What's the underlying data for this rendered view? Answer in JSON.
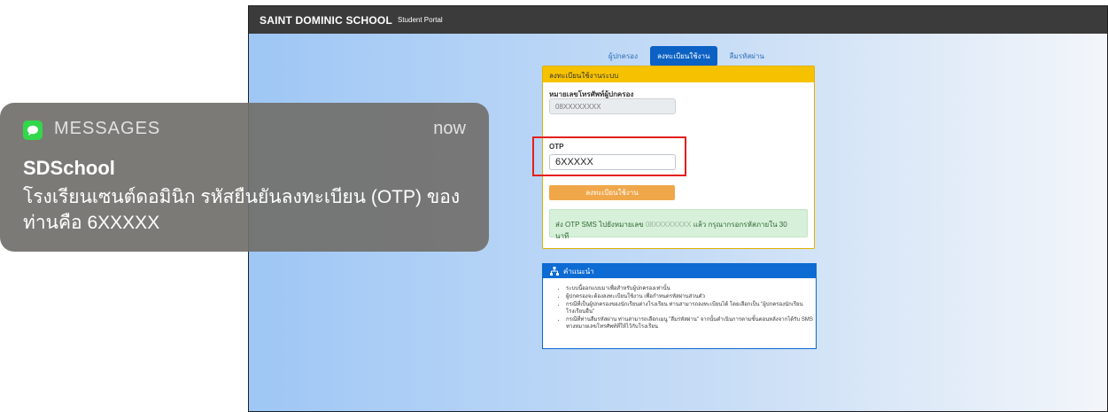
{
  "portal": {
    "brand": "SAINT DOMINIC SCHOOL",
    "brand_sub": "Student Portal",
    "tabs": [
      {
        "label": "ผู้ปกครอง",
        "active": false
      },
      {
        "label": "ลงทะเบียนใช้งาน",
        "active": true
      },
      {
        "label": "ลืมรหัสผ่าน",
        "active": false
      }
    ],
    "register_card": {
      "header": "ลงทะเบียนใช้งานระบบ",
      "phone_label": "หมายเลขโทรศัพท์ผู้ปกครอง",
      "phone_value": "08XXXXXXXX",
      "otp_label": "OTP",
      "otp_value": "6XXXXX",
      "submit_label": "ลงทะเบียนใช้งาน",
      "notice_prefix": "ส่ง OTP SMS ไปยังหมายเลข",
      "notice_number": "08XXXXXXXX",
      "notice_suffix": "แล้ว กรุณากรอกรหัสภายใน 30 นาที"
    },
    "info_card": {
      "header": "คำแนะนำ",
      "items": [
        "ระบบนี้ออกแบบมาเพื่อสำหรับผู้ปกครองเท่านั้น",
        "ผู้ปกครองจะต้องลงทะเบียนใช้งาน เพื่อกำหนดรหัสผ่านส่วนตัว",
        "กรณีที่เป็นผู้ปกครองของนักเรียนต่างโรงเรียน ท่านสามารถลงทะเบียนได้ โดยเลือกเป็น \"ผู้ปกครองนักเรียนโรงเรียนอื่น\"",
        "กรณีที่ท่านลืมรหัสผ่าน ท่านสามารถเลือกเมนู \"ลืมรหัสผ่าน\" จากนั้นดำเนินการตามขั้นตอนหลังจากได้รับ SMS ทางหมายเลขโทรศัพท์ที่ให้ไว้กับโรงเรียน"
      ]
    }
  },
  "notification": {
    "app_name": "MESSAGES",
    "time": "now",
    "sender": "SDSchool",
    "body_line1": "โรงเรียนเซนต์ดอมินิก รหัสยืนยันลงทะเบียน (OTP) ของ",
    "body_line2": "ท่านคือ  6XXXXX"
  },
  "colors": {
    "navbar": "#3b3b3b",
    "active_tab": "#0b61c4",
    "card_header": "#f6c200",
    "submit_button": "#f0a74a",
    "notice_bg": "#d7f0d9",
    "info_header": "#0d6bd3",
    "highlight": "#e41f1f",
    "messages_green": "#32d74b"
  },
  "icons": {
    "messages": "chat-bubble-icon",
    "info": "sitemap-icon"
  }
}
